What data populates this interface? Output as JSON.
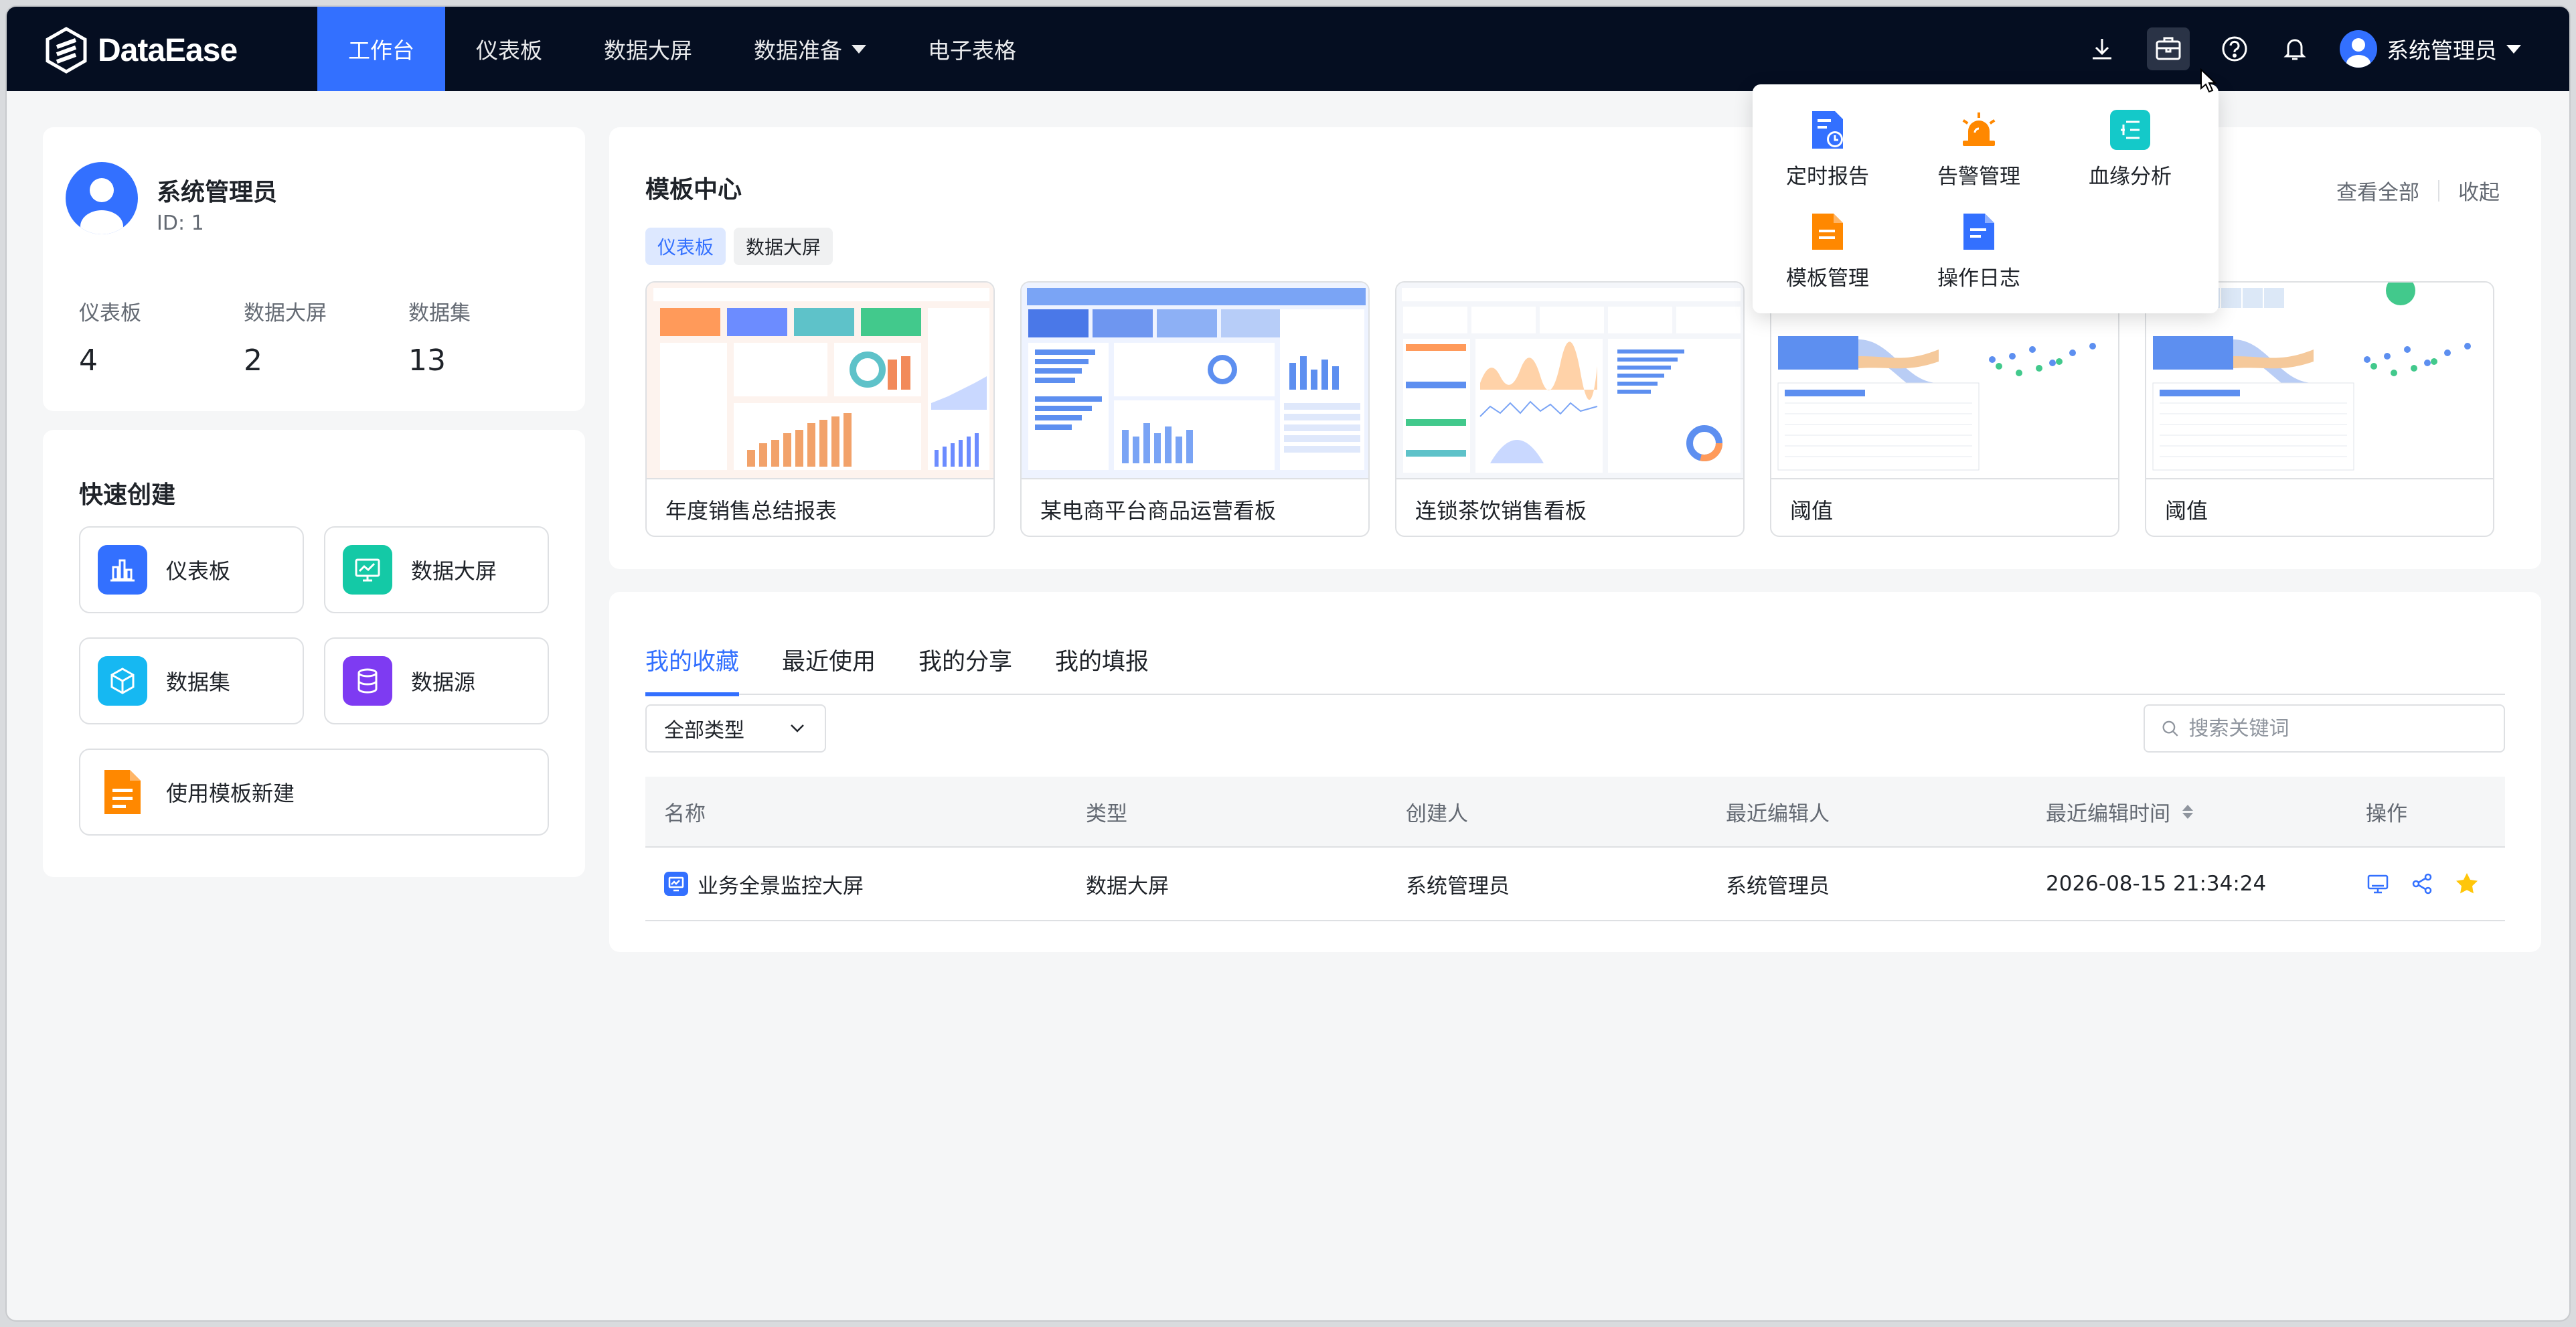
{
  "app": {
    "name": "DataEase"
  },
  "nav": {
    "items": [
      {
        "label": "工作台"
      },
      {
        "label": "仪表板"
      },
      {
        "label": "数据大屏"
      },
      {
        "label": "数据准备"
      },
      {
        "label": "电子表格"
      }
    ],
    "user_name": "系统管理员"
  },
  "popover": {
    "items": [
      {
        "label": "定时报告",
        "icon": "scheduled-report-icon",
        "color": "#3370ff"
      },
      {
        "label": "告警管理",
        "icon": "alarm-icon",
        "color": "#ff8800"
      },
      {
        "label": "血缘分析",
        "icon": "lineage-icon",
        "color": "#14c9c9"
      },
      {
        "label": "模板管理",
        "icon": "template-icon",
        "color": "#ff8800"
      },
      {
        "label": "操作日志",
        "icon": "log-icon",
        "color": "#3370ff"
      }
    ]
  },
  "profile": {
    "name": "系统管理员",
    "id": "ID: 1",
    "stats": [
      {
        "label": "仪表板",
        "value": "4"
      },
      {
        "label": "数据大屏",
        "value": "2"
      },
      {
        "label": "数据集",
        "value": "13"
      }
    ]
  },
  "quick": {
    "title": "快速创建",
    "items": [
      {
        "label": "仪表板",
        "icon": "dashboard-icon",
        "color": "#3370ff"
      },
      {
        "label": "数据大屏",
        "icon": "screen-icon",
        "color": "#14c9a6"
      },
      {
        "label": "数据集",
        "icon": "dataset-icon",
        "color": "#16b8f2"
      },
      {
        "label": "数据源",
        "icon": "datasource-icon",
        "color": "#7e3bf2"
      },
      {
        "label": "使用模板新建",
        "icon": "template-new-icon",
        "color": "#ff8800"
      }
    ]
  },
  "templates": {
    "title": "模板中心",
    "view_all": "查看全部",
    "collapse": "收起",
    "tags": [
      "仪表板",
      "数据大屏"
    ],
    "cards": [
      {
        "name": "年度销售总结报表"
      },
      {
        "name": "某电商平台商品运营看板"
      },
      {
        "name": "连锁茶饮销售看板"
      },
      {
        "name": "阈值"
      },
      {
        "name": "阈值"
      }
    ]
  },
  "favorites": {
    "tabs": [
      "我的收藏",
      "最近使用",
      "我的分享",
      "我的填报"
    ],
    "type_select": "全部类型",
    "search_placeholder": "搜索关键词",
    "columns": [
      "名称",
      "类型",
      "创建人",
      "最近编辑人",
      "最近编辑时间",
      "操作"
    ],
    "rows": [
      {
        "name": "业务全景监控大屏",
        "type": "数据大屏",
        "creator": "系统管理员",
        "editor": "系统管理员",
        "time": "2026-08-15 21:34:24"
      }
    ]
  },
  "colors": {
    "primary": "#3370ff",
    "nav_bg": "#050e21",
    "star": "#ffc60a"
  }
}
